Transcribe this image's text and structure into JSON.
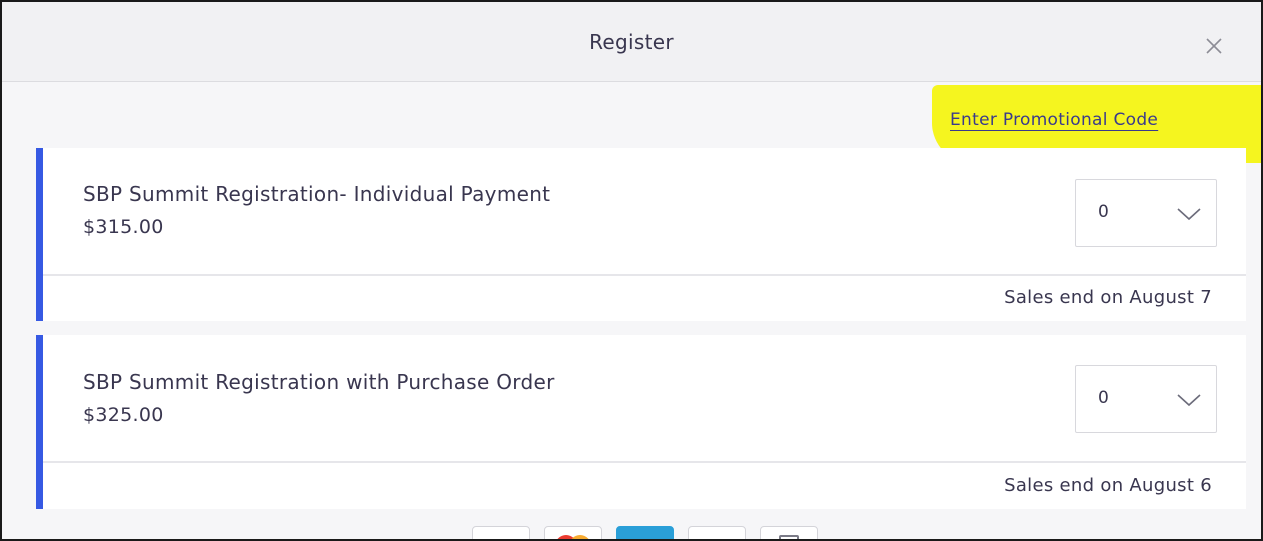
{
  "modal": {
    "title": "Register",
    "close_icon": "close-icon",
    "promo_link": "Enter Promotional Code"
  },
  "tickets": [
    {
      "name": "SBP Summit Registration- Individual Payment",
      "price": "$315.00",
      "quantity": "0",
      "sales_end": "Sales end on August 7"
    },
    {
      "name": "SBP Summit Registration with Purchase Order",
      "price": "$325.00",
      "quantity": "0",
      "sales_end": "Sales end on August 6"
    }
  ],
  "payment_icons": [
    "visa-icon",
    "mastercard-icon",
    "amex-icon",
    "discover-icon",
    "generic-card-icon"
  ],
  "colors": {
    "accent_bar": "#3659e3",
    "highlight": "#f5f51f",
    "text": "#39364f",
    "link": "#3a3a8c"
  }
}
